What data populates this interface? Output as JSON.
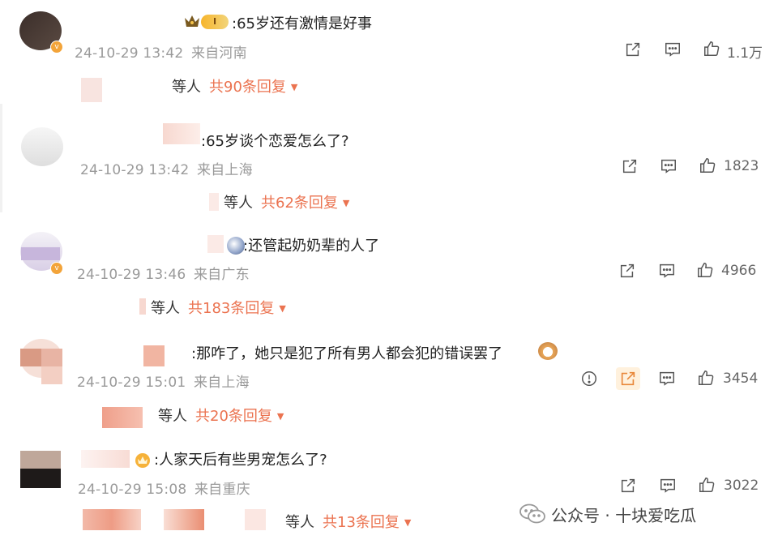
{
  "comments": [
    {
      "text": ":65岁还有激情是好事",
      "time": "24-10-29 13:42",
      "location": "来自河南",
      "likes": "1.1万",
      "reply_by": "等人",
      "reply_count": "共90条回复",
      "badge": "I"
    },
    {
      "text": ":65岁谈个恋爱怎么了?",
      "time": "24-10-29 13:42",
      "location": "来自上海",
      "likes": "1823",
      "reply_by": "等人",
      "reply_count": "共62条回复"
    },
    {
      "text": ":还管起奶奶辈的人了",
      "time": "24-10-29 13:46",
      "location": "来自广东",
      "likes": "4966",
      "reply_by": "等人",
      "reply_count": "共183条回复"
    },
    {
      "text": ":那咋了，她只是犯了所有男人都会犯的错误罢了",
      "time": "24-10-29 15:01",
      "location": "来自上海",
      "likes": "3454",
      "reply_by": "等人",
      "reply_count": "共20条回复"
    },
    {
      "text": ":人家天后有些男宠怎么了?",
      "time": "24-10-29 15:08",
      "location": "来自重庆",
      "likes": "3022",
      "reply_by": "等人",
      "reply_count": "共13条回复"
    }
  ],
  "watermark": "公众号 · 十块爱吃瓜",
  "icons": {
    "share": "share-icon",
    "comment": "comment-icon",
    "like": "thumbs-up-icon",
    "report": "report-icon",
    "expand": "caret-down-icon"
  },
  "colors": {
    "accent": "#eb7350",
    "meta": "#9a9a9a",
    "badge": "#f3a43a"
  }
}
